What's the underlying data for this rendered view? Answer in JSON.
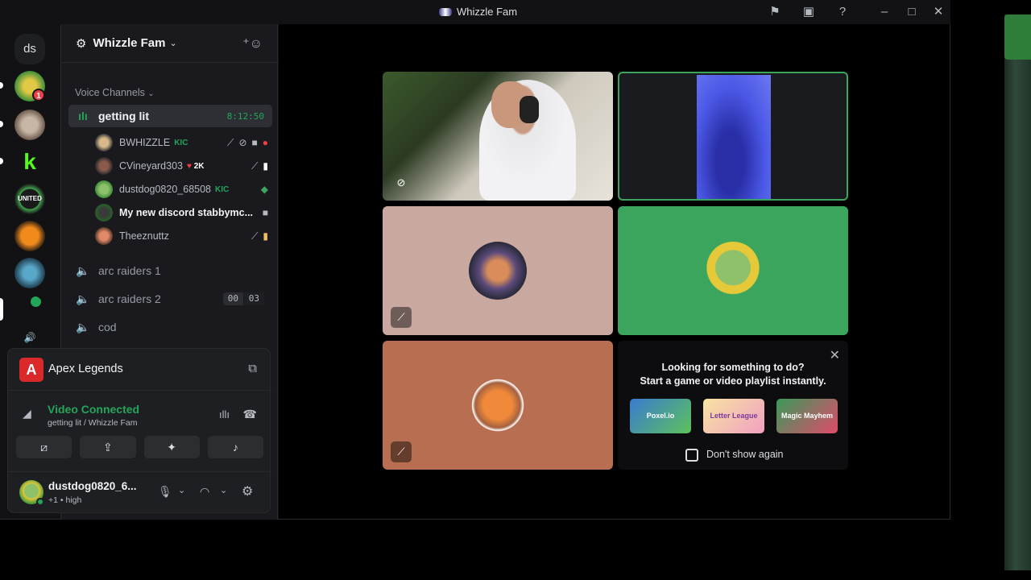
{
  "window": {
    "title": "Whizzle Fam"
  },
  "servers": {
    "ds_label": "ds",
    "badge": "1"
  },
  "guild": {
    "name": "Whizzle Fam"
  },
  "voice": {
    "category": "Voice Channels",
    "active_channel": {
      "name": "getting lit",
      "timer": "8:12:50"
    },
    "members": [
      {
        "name": "BWHIZZLE",
        "tag": "KIC",
        "bold": false
      },
      {
        "name": "CVineyard303",
        "tag": "2K",
        "bold": false
      },
      {
        "name": "dustdog0820_68508",
        "tag": "KIC",
        "bold": false
      },
      {
        "name": "My new discord stabbymc...",
        "tag": "",
        "bold": true
      },
      {
        "name": "Theeznuttz",
        "tag": "",
        "bold": false
      }
    ],
    "channels": [
      {
        "name": "arc raiders 1"
      },
      {
        "name": "arc raiders 2",
        "count_a": "00",
        "count_b": "03"
      },
      {
        "name": "cod"
      }
    ]
  },
  "activity": {
    "game": "Apex Legends"
  },
  "connection": {
    "status": "Video Connected",
    "detail": "getting lit / Whizzle Fam"
  },
  "user": {
    "name": "dustdog0820_6...",
    "status": "+1 • high"
  },
  "promo": {
    "line1": "Looking for something to do?",
    "line2": "Start a game or video playlist instantly.",
    "games": [
      "Poxel.io",
      "Letter League",
      "Magic Mayhem"
    ],
    "dont_show": "Don't show again"
  },
  "colors": {
    "accent_green": "#23a55a",
    "brand_red": "#f23f43",
    "speaking_border": "#3ba55d"
  }
}
